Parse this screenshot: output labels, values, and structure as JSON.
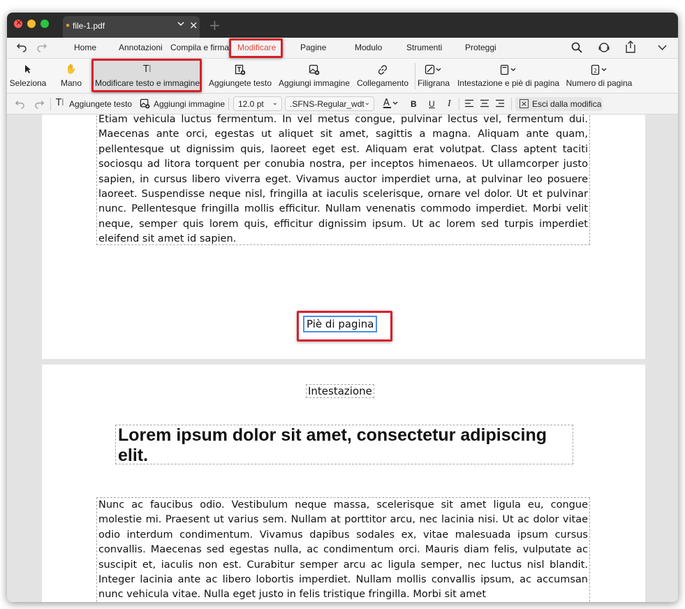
{
  "window": {
    "tab_title": "file-1.pdf",
    "tab_dot": "●",
    "new_tab": "+"
  },
  "menu": {
    "home": "Home",
    "annotations": "Annotazioni",
    "fill_sign": "Compila e firma",
    "edit": "Modificare",
    "pages": "Pagine",
    "form": "Modulo",
    "tools": "Strumenti",
    "protect": "Proteggi",
    "active_color": "#e5493b"
  },
  "ribbon": {
    "select": "Seleziona",
    "hand": "Mano",
    "edit_text_image": "Modificare testo e immagine",
    "add_text": "Aggiungete testo",
    "add_image": "Aggiungi immagine",
    "link": "Collegamento",
    "watermark": "Filigrana",
    "header_footer": "Intestazione e piè di pagina",
    "page_number": "Numero di pagina"
  },
  "format_bar": {
    "add_text": "Aggiungete testo",
    "add_image": "Aggiungi immagine",
    "font_size": "12.0 pt",
    "font_name": ".SFNS-Regular_wdt",
    "bold": "B",
    "underline": "U",
    "italic": "I",
    "exit_edit": "Esci dalla modifica"
  },
  "document": {
    "page1_paragraph": "Etiam vehicula luctus fermentum. In vel metus congue, pulvinar lectus vel, fermentum dui. Maecenas ante orci, egestas ut aliquet sit amet, sagittis a magna. Aliquam ante quam, pellentesque ut dignissim quis, laoreet eget est. Aliquam erat volutpat. Class aptent taciti sociosqu ad litora torquent per conubia nostra, per inceptos himenaeos. Ut ullamcorper justo sapien, in cursus libero viverra eget. Vivamus auctor imperdiet urna, at pulvinar leo posuere laoreet. Suspendisse neque nisl, fringilla at iaculis scelerisque, ornare vel dolor. Ut et pulvinar nunc. Pellentesque fringilla mollis efficitur. Nullam venenatis commodo imperdiet. Morbi velit neque, semper quis lorem quis, efficitur dignissim ipsum. Ut ac lorem sed turpis imperdiet eleifend sit amet id sapien.",
    "footer": "Piè di pagina",
    "header": "Intestazione",
    "page2_title": "Lorem ipsum dolor sit amet, consectetur adipiscing elit.",
    "page2_paragraph": "Nunc ac faucibus odio. Vestibulum neque massa, scelerisque sit amet ligula eu, congue molestie mi. Praesent ut varius sem. Nullam at porttitor arcu, nec lacinia nisi. Ut ac dolor vitae odio interdum condimentum. Vivamus dapibus sodales ex, vitae malesuada ipsum cursus convallis. Maecenas sed egestas nulla, ac condimentum orci. Mauris diam felis, vulputate ac suscipit et, iaculis non est. Curabitur semper arcu ac ligula semper, nec luctus nisl blandit. Integer lacinia ante ac libero lobortis imperdiet. Nullam mollis convallis ipsum, ac accumsan nunc vehicula vitae. Nulla eget justo in felis tristique fringilla. Morbi sit amet"
  },
  "icons": {
    "undo": "undo-icon",
    "redo": "redo-icon",
    "search": "search-icon",
    "user_support": "headset-icon",
    "share": "share-icon",
    "expand": "chevron-down-icon"
  },
  "highlight_color": "#d8202a"
}
